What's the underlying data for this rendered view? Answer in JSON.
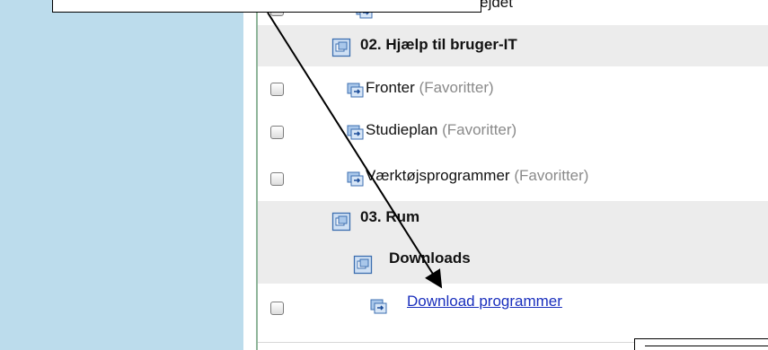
{
  "rows": [
    {
      "label": "",
      "type": "item",
      "partial_text": "rbejdet"
    },
    {
      "label": "02. Hjælp til bruger-IT",
      "type": "folder"
    },
    {
      "label": "Fronter",
      "suffix": "(Favoritter)",
      "type": "item"
    },
    {
      "label": "Studieplan",
      "suffix": "(Favoritter)",
      "type": "item"
    },
    {
      "label": "Værktøjsprogrammer",
      "suffix": "(Favoritter)",
      "type": "item"
    },
    {
      "label": "03. Rum",
      "type": "folder"
    },
    {
      "label": "Downloads",
      "type": "folder"
    },
    {
      "label": "Download programmer",
      "type": "link"
    }
  ],
  "colors": {
    "sidebar": "#bcdcec",
    "row_shaded": "#ececec",
    "link": "#1a2fbd",
    "favorite_suffix": "#8a8a8a",
    "tree_line": "#8fb59a"
  },
  "icons": {
    "folder": "folder-room-icon",
    "item": "linked-content-icon"
  },
  "annotation": {
    "type": "arrow",
    "points_to": "Download programmer"
  }
}
